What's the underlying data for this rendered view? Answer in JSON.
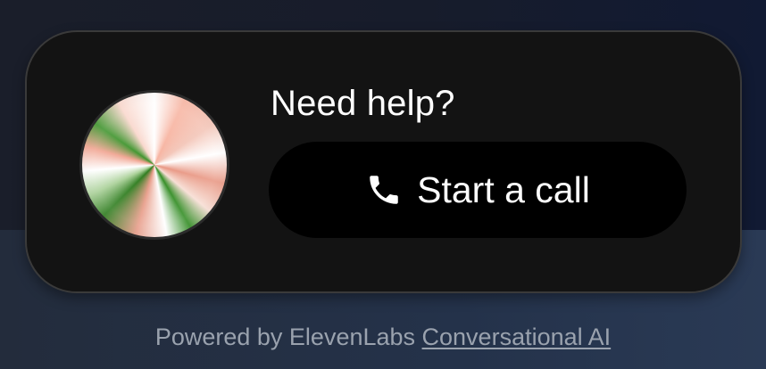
{
  "widget": {
    "title": "Need help?",
    "call_button": {
      "label": "Start a call",
      "icon": "phone-icon"
    },
    "avatar": {
      "icon": "orb-avatar"
    }
  },
  "footer": {
    "prefix": "Powered by ElevenLabs",
    "link_text": "Conversational AI"
  },
  "colors": {
    "widget_background": "#131313",
    "button_background": "#000000",
    "text_primary": "#ffffff",
    "footer_text": "#9aa2ae",
    "orb_green": "#2d8a1e",
    "orb_pink": "#f7b3a0"
  }
}
